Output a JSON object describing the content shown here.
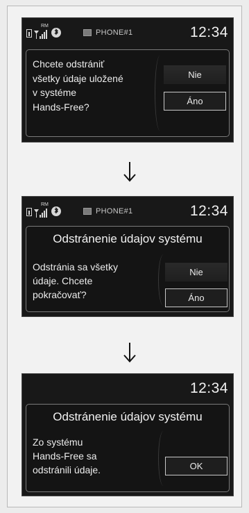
{
  "screen1": {
    "status": {
      "phone_name": "PHONE#1",
      "clock": "12:34",
      "roaming": "RM"
    },
    "dialog": {
      "message_lines": [
        "Chcete odstrániť",
        "všetky údaje uložené",
        "v systéme",
        "Hands-Free?"
      ],
      "buttons": {
        "no": "Nie",
        "yes": "Áno"
      },
      "selected": "yes"
    }
  },
  "screen2": {
    "status": {
      "phone_name": "PHONE#1",
      "clock": "12:34",
      "roaming": "RM"
    },
    "dialog": {
      "title": "Odstránenie údajov systému",
      "message_lines": [
        "Odstránia sa všetky",
        "údaje. Chcete",
        "pokračovať?"
      ],
      "buttons": {
        "no": "Nie",
        "yes": "Áno"
      },
      "selected": "yes"
    }
  },
  "screen3": {
    "status": {
      "clock": "12:34"
    },
    "dialog": {
      "title": "Odstránenie údajov systému",
      "message_lines": [
        "Zo systému",
        "Hands-Free sa",
        "odstránili údaje."
      ],
      "buttons": {
        "ok": "OK"
      },
      "selected": "ok"
    }
  },
  "flow_arrows": [
    "arrow-down-icon",
    "arrow-down-icon"
  ]
}
